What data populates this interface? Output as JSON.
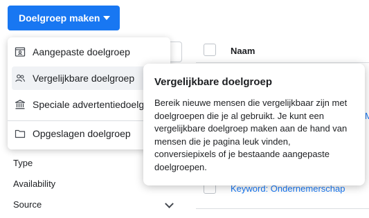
{
  "toolbar": {
    "create_label": "Doelgroep maken"
  },
  "table": {
    "column_name": "Naam",
    "row_link": "Keyword: Ondernemerschap",
    "edge_link": "M"
  },
  "filters": {
    "type": "Type",
    "availability": "Availability",
    "source": "Source"
  },
  "menu": {
    "items": [
      {
        "label": "Aangepaste doelgroep",
        "icon": "custom-audience-icon"
      },
      {
        "label": "Vergelijkbare doelgroep",
        "icon": "people-icon"
      },
      {
        "label": "Speciale advertentiedoelgroep",
        "icon": "institution-icon"
      },
      {
        "label": "Opgeslagen doelgroep",
        "icon": "folder-icon"
      }
    ]
  },
  "tooltip": {
    "title": "Vergelijkbare doelgroep",
    "body": "Bereik nieuwe mensen die vergelijkbaar zijn met doelgroepen die je al gebruikt. Je kunt een vergelijkbare doelgroep maken aan de hand van mensen die je pagina leuk vinden, conversiepixels of je bestaande aangepaste doelgroepen."
  },
  "colors": {
    "primary": "#1877f2",
    "hover": "#f0f2f5",
    "text": "#1c1e21"
  }
}
